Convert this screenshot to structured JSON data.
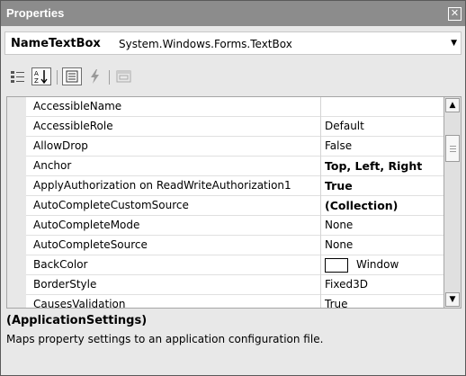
{
  "window": {
    "title": "Properties"
  },
  "object_selector": {
    "name": "NameTextBox",
    "type": "System.Windows.Forms.TextBox"
  },
  "toolbar": {
    "buttons": [
      {
        "name": "categorized-icon",
        "active": false
      },
      {
        "name": "alphabetical-icon",
        "active": true
      },
      {
        "name": "properties-icon",
        "active": true
      },
      {
        "name": "events-icon",
        "active": false
      },
      {
        "name": "property-pages-icon",
        "active": false
      }
    ]
  },
  "properties": [
    {
      "name": "AccessibleName",
      "value": ""
    },
    {
      "name": "AccessibleRole",
      "value": "Default"
    },
    {
      "name": "AllowDrop",
      "value": "False"
    },
    {
      "name": "Anchor",
      "value": "Top, Left, Right",
      "bold": true
    },
    {
      "name": "ApplyAuthorization on ReadWriteAuthorization1",
      "value": "True",
      "bold": true
    },
    {
      "name": "AutoCompleteCustomSource",
      "value": "(Collection)",
      "bold": true
    },
    {
      "name": "AutoCompleteMode",
      "value": "None"
    },
    {
      "name": "AutoCompleteSource",
      "value": "None"
    },
    {
      "name": "BackColor",
      "value": "Window",
      "swatch": "#ffffff"
    },
    {
      "name": "BorderStyle",
      "value": "Fixed3D"
    },
    {
      "name": "CausesValidation",
      "value": "True"
    }
  ],
  "description": {
    "title": "(ApplicationSettings)",
    "text": "Maps property settings to an application configuration file."
  },
  "colors": {
    "titlebar": "#8c8c8c",
    "panel": "#e8e8e8",
    "grid_line": "#e0e0e0"
  }
}
